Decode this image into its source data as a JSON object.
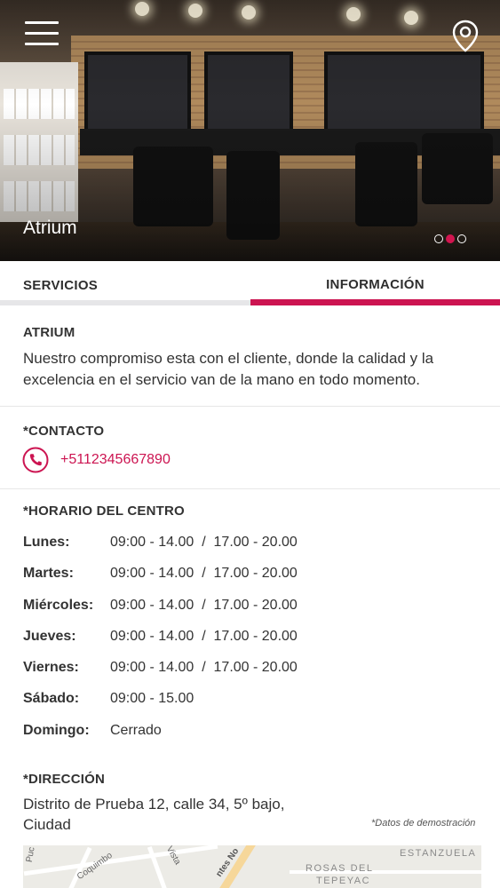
{
  "hero": {
    "title": "Atrium",
    "slide_count": 3,
    "active_slide": 2,
    "menu_icon": "hamburger-menu-icon",
    "location_icon": "map-pin-icon"
  },
  "tabs": [
    {
      "label": "SERVICIOS",
      "active": false
    },
    {
      "label": "INFORMACIÓN",
      "active": true
    }
  ],
  "colors": {
    "accent": "#cc1451",
    "text": "#333333",
    "inactive_tab_bar": "#e6e6e8"
  },
  "about": {
    "title": "ATRIUM",
    "description": "Nuestro compromiso esta con el cliente, donde la calidad y la excelencia en el servicio van de la mano en todo momento."
  },
  "contact": {
    "title": "*CONTACTO",
    "phone": "+5112345667890",
    "phone_icon": "phone-icon"
  },
  "schedule": {
    "title": "*HORARIO DEL CENTRO",
    "rows": [
      {
        "day": "Lunes:",
        "hours": "09:00 - 14.00  /  17.00 - 20.00"
      },
      {
        "day": "Martes:",
        "hours": "09:00 - 14.00  /  17.00 - 20.00"
      },
      {
        "day": "Miércoles:",
        "hours": "09:00 - 14.00  /  17.00 - 20.00"
      },
      {
        "day": "Jueves:",
        "hours": "09:00 - 14.00  /  17.00 - 20.00"
      },
      {
        "day": "Viernes:",
        "hours": "09:00 - 14.00  /  17.00 - 20.00"
      },
      {
        "day": "Sábado:",
        "hours": "09:00 - 15.00"
      },
      {
        "day": "Domingo:",
        "hours": "Cerrado"
      }
    ]
  },
  "address": {
    "title": "*DIRECCIÓN",
    "line1": "Distrito de Prueba 12, calle 34, 5º bajo,",
    "line2": "Ciudad",
    "demo_note": "*Datos de demostración"
  },
  "map": {
    "labels": [
      "Coquimbo",
      "Puc",
      "Vista",
      "ntes No",
      "ESTANZUELA",
      "ROSAS DEL",
      "TEPEYAC"
    ]
  }
}
